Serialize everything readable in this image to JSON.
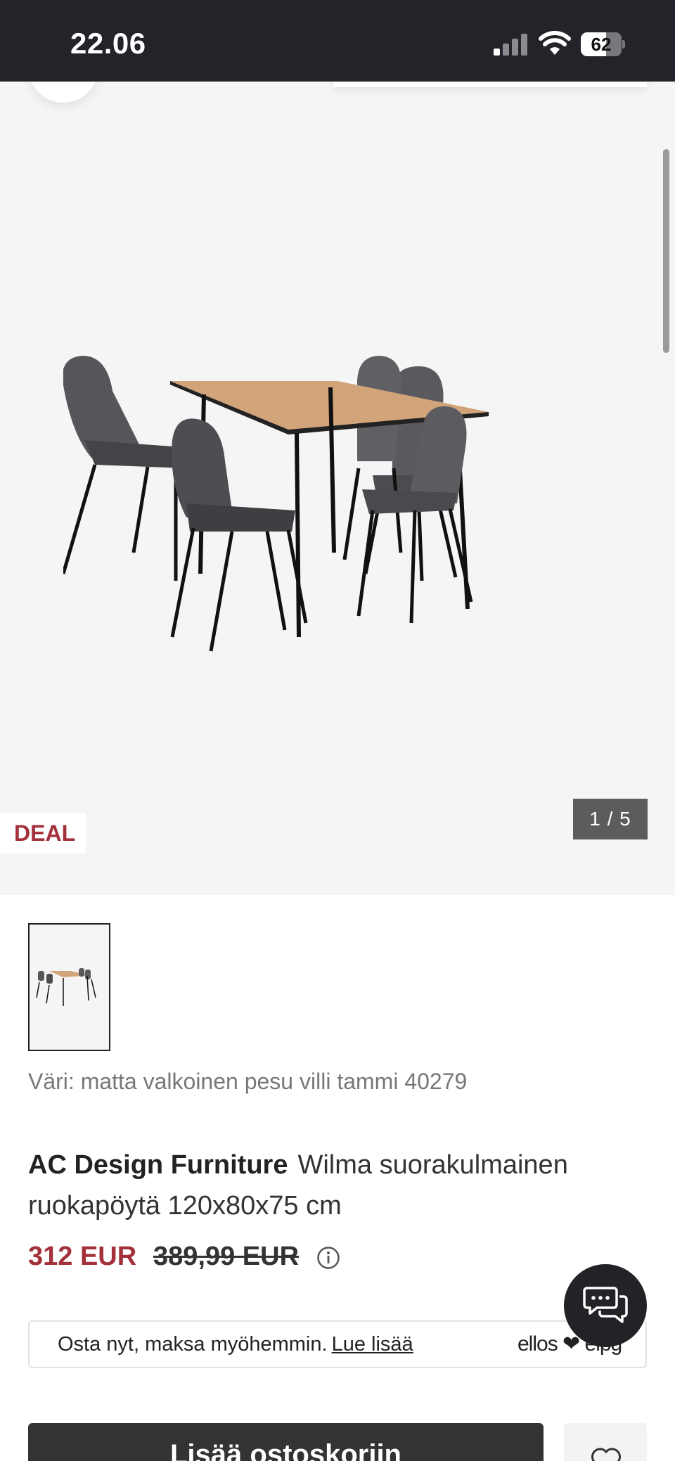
{
  "status_bar": {
    "time": "22.06",
    "battery": "62",
    "battery_level_percent": 62,
    "signal_bars_active": 1,
    "icons": [
      "signal-icon",
      "wifi-icon",
      "battery-icon"
    ]
  },
  "gallery": {
    "badge": "DEAL",
    "counter": "1 / 5",
    "image_semantic": "dining-table-set-image"
  },
  "product": {
    "color_label": "Väri: matta valkoinen pesu villi tammi 40279",
    "brand": "AC Design Furniture",
    "name": "Wilma suorakulmainen ruokapöytä 120x80x75 cm",
    "price_current": "312 EUR",
    "price_original": "389,99 EUR"
  },
  "bnpl": {
    "text": "Osta nyt, maksa myöhemmin.",
    "link": "Lue lisää",
    "logo": "ellos ❤ elpg"
  },
  "actions": {
    "add_to_cart": "Lisää ostoskoriin",
    "chat_icon": "chat-icon",
    "wishlist_icon": "heart-icon"
  },
  "colors": {
    "status_bar": "#232429",
    "accent_red": "#a3303b",
    "gallery_bg": "#f5f5f5",
    "button_dark": "#333333"
  }
}
